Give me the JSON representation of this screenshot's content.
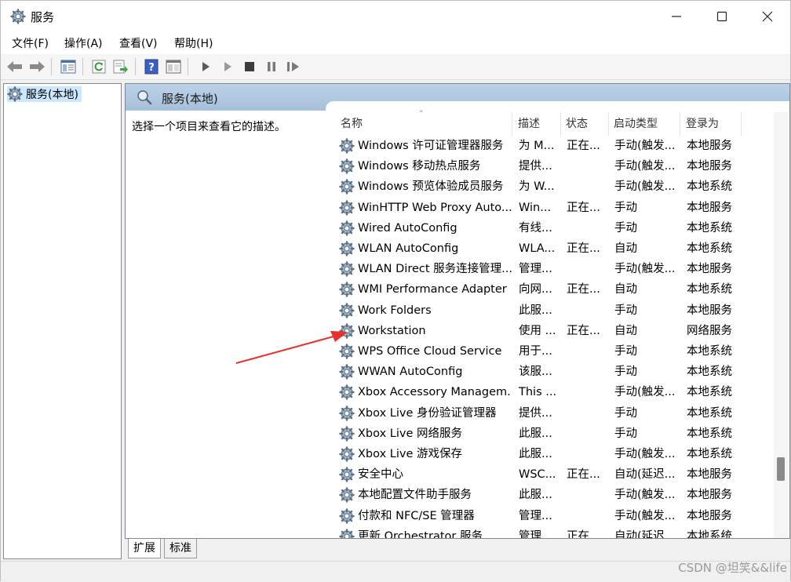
{
  "window": {
    "title": "服务"
  },
  "menu": [
    "文件(F)",
    "操作(A)",
    "查看(V)",
    "帮助(H)"
  ],
  "tree": {
    "root_label": "服务(本地)"
  },
  "pane": {
    "header": "服务(本地)",
    "description": "选择一个项目来查看它的描述。"
  },
  "columns": {
    "name": "名称",
    "desc": "描述",
    "state": "状态",
    "start": "启动类型",
    "logon": "登录为"
  },
  "rows": [
    {
      "name": "Windows 许可证管理器服务",
      "desc": "为 M...",
      "state": "正在...",
      "start": "手动(触发...",
      "logon": "本地服务"
    },
    {
      "name": "Windows 移动热点服务",
      "desc": "提供...",
      "state": "",
      "start": "手动(触发...",
      "logon": "本地服务"
    },
    {
      "name": "Windows 预览体验成员服务",
      "desc": "为 W...",
      "state": "",
      "start": "手动(触发...",
      "logon": "本地系统"
    },
    {
      "name": "WinHTTP Web Proxy Auto...",
      "desc": "Win...",
      "state": "正在...",
      "start": "手动",
      "logon": "本地服务"
    },
    {
      "name": "Wired AutoConfig",
      "desc": "有线...",
      "state": "",
      "start": "手动",
      "logon": "本地系统"
    },
    {
      "name": "WLAN AutoConfig",
      "desc": "WLA...",
      "state": "正在...",
      "start": "自动",
      "logon": "本地系统"
    },
    {
      "name": "WLAN Direct 服务连接管理...",
      "desc": "管理...",
      "state": "",
      "start": "手动(触发...",
      "logon": "本地服务"
    },
    {
      "name": "WMI Performance Adapter",
      "desc": "向网...",
      "state": "正在...",
      "start": "自动",
      "logon": "本地系统"
    },
    {
      "name": "Work Folders",
      "desc": "此服...",
      "state": "",
      "start": "手动",
      "logon": "本地服务"
    },
    {
      "name": "Workstation",
      "desc": "使用 ...",
      "state": "正在...",
      "start": "自动",
      "logon": "网络服务"
    },
    {
      "name": "WPS Office Cloud Service",
      "desc": "用于...",
      "state": "",
      "start": "手动",
      "logon": "本地系统"
    },
    {
      "name": "WWAN AutoConfig",
      "desc": "该服...",
      "state": "",
      "start": "手动",
      "logon": "本地系统"
    },
    {
      "name": "Xbox Accessory Managem...",
      "desc": "This ...",
      "state": "",
      "start": "手动(触发...",
      "logon": "本地系统"
    },
    {
      "name": "Xbox Live 身份验证管理器",
      "desc": "提供...",
      "state": "",
      "start": "手动",
      "logon": "本地系统"
    },
    {
      "name": "Xbox Live 网络服务",
      "desc": "此服...",
      "state": "",
      "start": "手动",
      "logon": "本地系统"
    },
    {
      "name": "Xbox Live 游戏保存",
      "desc": "此服...",
      "state": "",
      "start": "手动(触发...",
      "logon": "本地系统"
    },
    {
      "name": "安全中心",
      "desc": "WSC...",
      "state": "正在...",
      "start": "自动(延迟...",
      "logon": "本地服务"
    },
    {
      "name": "本地配置文件助手服务",
      "desc": "此服...",
      "state": "",
      "start": "手动(触发...",
      "logon": "本地服务"
    },
    {
      "name": "付款和 NFC/SE 管理器",
      "desc": "管理...",
      "state": "",
      "start": "手动(触发...",
      "logon": "本地服务"
    },
    {
      "name": "更新 Orchestrator 服务",
      "desc": "管理...",
      "state": "正在...",
      "start": "自动(延迟...",
      "logon": "本地系统"
    }
  ],
  "tabs": [
    "扩展",
    "标准"
  ],
  "watermark": "CSDN @坦笑&&life",
  "icons": {
    "title": "gear-icon",
    "toolbar": [
      "back-arrow-icon",
      "forward-arrow-icon",
      "console-tree-icon",
      "refresh-icon",
      "export-list-icon",
      "help-icon",
      "properties-icon",
      "start-service-icon",
      "start-service-alt-icon",
      "stop-service-icon",
      "pause-service-icon",
      "resume-service-icon"
    ],
    "window": [
      "minimize-icon",
      "maximize-icon",
      "close-icon"
    ]
  },
  "colors": {
    "selection": "#cce8ff",
    "pane_header": "#b3c9e2",
    "annotation_arrow": "#e8312a"
  }
}
